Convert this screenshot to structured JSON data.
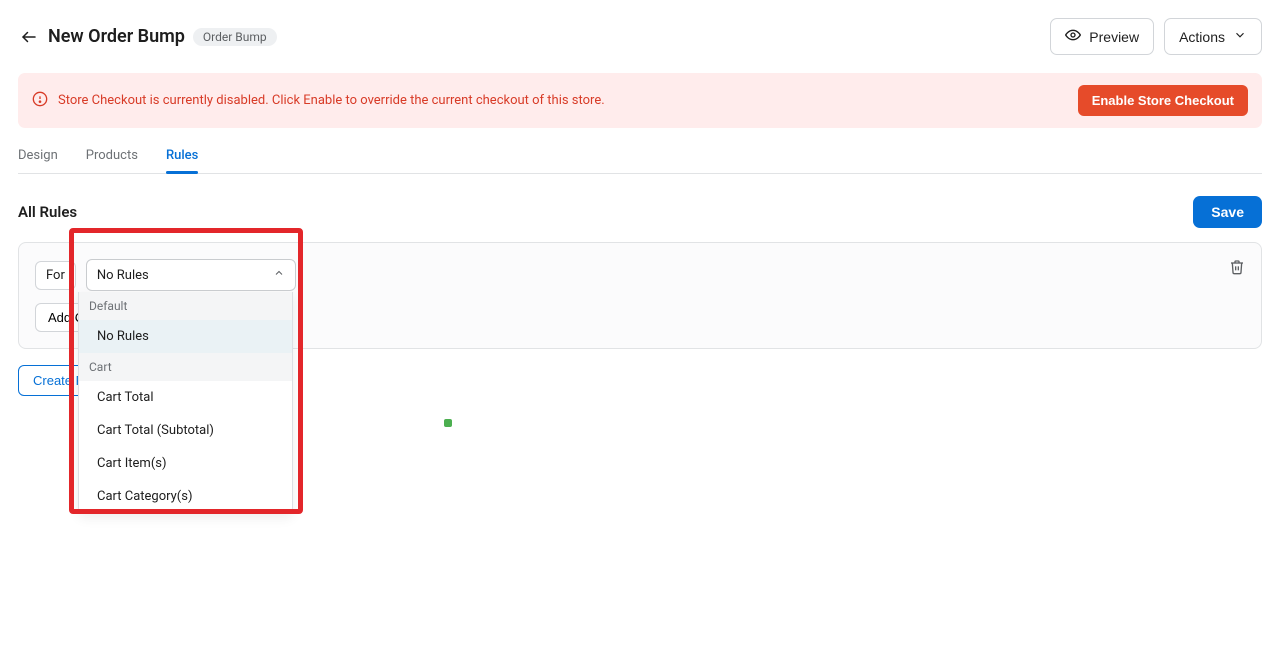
{
  "header": {
    "title": "New Order Bump",
    "badge": "Order Bump",
    "preview_label": "Preview",
    "actions_label": "Actions"
  },
  "alert": {
    "text": "Store Checkout is currently disabled. Click Enable to override the current checkout of this store.",
    "button_label": "Enable Store Checkout"
  },
  "tabs": {
    "design": "Design",
    "products": "Products",
    "rules": "Rules"
  },
  "rules": {
    "heading": "All Rules",
    "save_label": "Save",
    "for_label": "For",
    "select_value": "No Rules",
    "add_condition_label": "Add Condition",
    "create_rule_label": "Create Rules"
  },
  "dropdown": {
    "group_default": "Default",
    "item_no_rules": "No Rules",
    "group_cart": "Cart",
    "item_cart_total": "Cart Total",
    "item_cart_subtotal": "Cart Total (Subtotal)",
    "item_cart_items": "Cart Item(s)",
    "item_cart_categories": "Cart Category(s)"
  }
}
